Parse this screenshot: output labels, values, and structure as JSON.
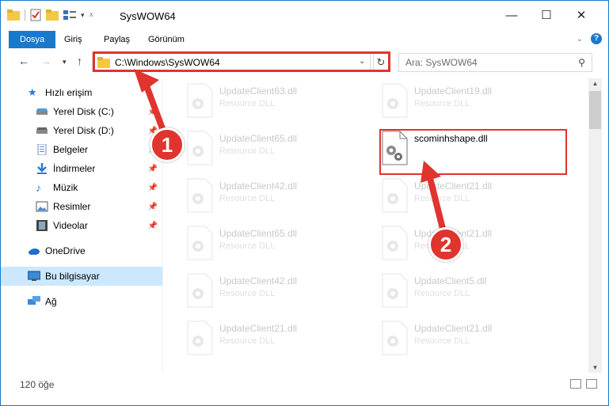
{
  "window": {
    "title": "SysWOW64",
    "minimize_icon": "minimize-icon",
    "maximize_icon": "maximize-icon",
    "close_icon": "close-icon"
  },
  "ribbon": {
    "tabs": [
      "Dosya",
      "Giriş",
      "Paylaş",
      "Görünüm"
    ]
  },
  "address": {
    "path": "C:\\Windows\\SysWOW64",
    "search_placeholder": "Ara: SysWOW64"
  },
  "sidebar": {
    "items": [
      {
        "label": "Hızlı erişim",
        "icon": "star-icon",
        "pinned": false
      },
      {
        "label": "Yerel Disk (C:)",
        "icon": "drive-icon",
        "pinned": true
      },
      {
        "label": "Yerel Disk (D:)",
        "icon": "drive-icon",
        "pinned": true
      },
      {
        "label": "Belgeler",
        "icon": "documents-icon",
        "pinned": true
      },
      {
        "label": "İndirmeler",
        "icon": "downloads-icon",
        "pinned": true
      },
      {
        "label": "Müzik",
        "icon": "music-icon",
        "pinned": true
      },
      {
        "label": "Resimler",
        "icon": "pictures-icon",
        "pinned": true
      },
      {
        "label": "Videolar",
        "icon": "videos-icon",
        "pinned": true
      },
      {
        "label": "OneDrive",
        "icon": "onedrive-icon",
        "pinned": false
      },
      {
        "label": "Bu bilgisayar",
        "icon": "computer-icon",
        "pinned": false
      },
      {
        "label": "Ağ",
        "icon": "network-icon",
        "pinned": false
      }
    ]
  },
  "files": [
    {
      "name": "UpdateClient63.dll",
      "type": "Resource DLL"
    },
    {
      "name": "UpdateClient19.dll",
      "type": "Resource DLL"
    },
    {
      "name": "UpdateClient65.dll",
      "type": "Resource DLL"
    },
    {
      "name": "scominhshape.dll",
      "type": ""
    },
    {
      "name": "UpdateClient42.dll",
      "type": "Resource DLL"
    },
    {
      "name": "UpdateClient21.dll",
      "type": "Resource DLL"
    },
    {
      "name": "UpdateClient65.dll",
      "type": "Resource DLL"
    },
    {
      "name": "UpdateClient21.dll",
      "type": "Resource DLL"
    },
    {
      "name": "UpdateClient42.dll",
      "type": "Resource DLL"
    },
    {
      "name": "UpdateClient5.dll",
      "type": "Resource DLL"
    },
    {
      "name": "UpdateClient21.dll",
      "type": "Resource DLL"
    },
    {
      "name": "UpdateClient21.dll",
      "type": "Resource DLL"
    }
  ],
  "status": {
    "count": "120 öğe"
  },
  "annotations": {
    "step1": "1",
    "step2": "2"
  },
  "colors": {
    "accent": "#1979ca",
    "highlight": "#e0342f",
    "selected_bg": "#cce8ff"
  }
}
